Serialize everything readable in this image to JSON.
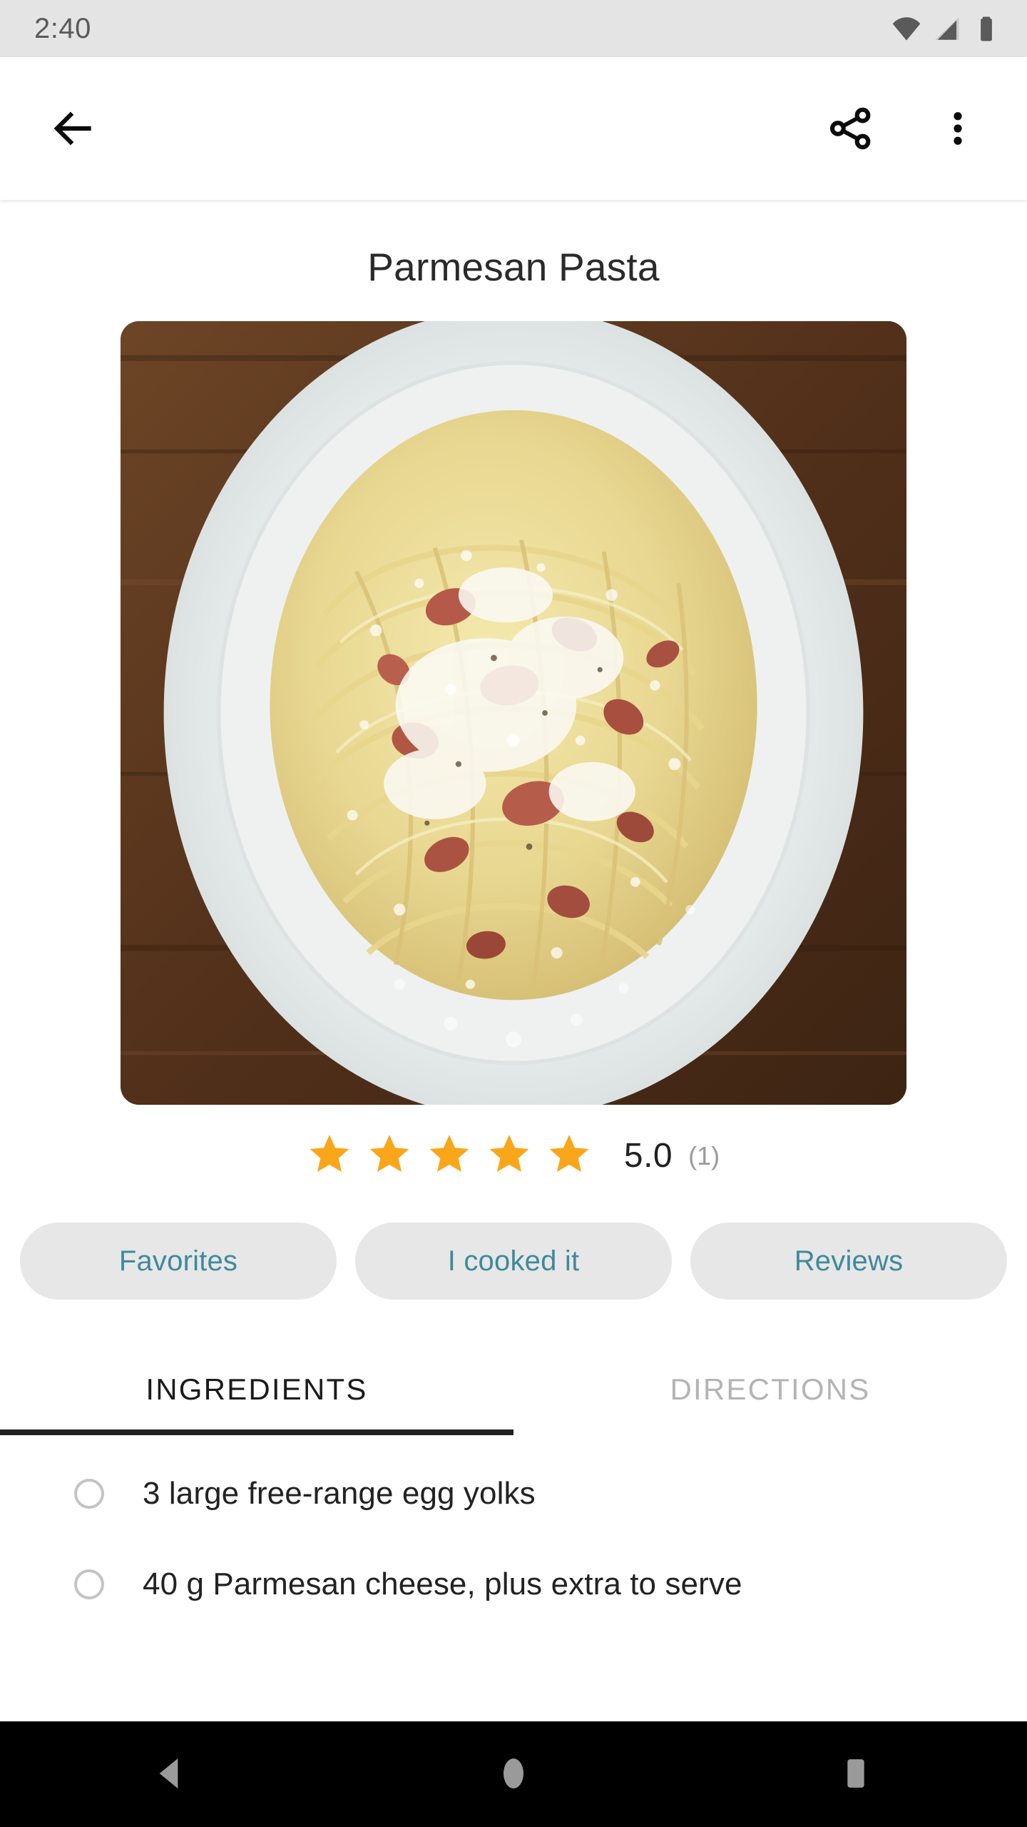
{
  "status_bar": {
    "time": "2:40",
    "icons": [
      "wifi-icon",
      "cellular-signal-icon",
      "battery-icon"
    ],
    "background": "#e4e4e4"
  },
  "app_bar": {
    "back_icon": "back-arrow-icon",
    "share_icon": "share-icon",
    "overflow_icon": "more-vert-icon"
  },
  "recipe": {
    "title": "Parmesan Pasta",
    "image_alt": "spaghetti carbonara with pancetta and grated parmesan on a white oval plate"
  },
  "rating": {
    "stars_filled": 5,
    "stars_total": 5,
    "value": "5.0",
    "count": "(1)",
    "star_color": "#FAA61A"
  },
  "actions": {
    "favorites_label": "Favorites",
    "cooked_label": "I cooked it",
    "reviews_label": "Reviews",
    "chip_background": "#e7e7e7",
    "chip_text_color": "#3f8a9b"
  },
  "tabs": {
    "items": [
      {
        "label": "INGREDIENTS",
        "active": true
      },
      {
        "label": "DIRECTIONS",
        "active": false
      }
    ],
    "indicator_color": "#202020"
  },
  "ingredients": [
    {
      "text": "3 large free-range egg yolks",
      "checked": false
    },
    {
      "text": "40 g Parmesan cheese, plus extra to serve",
      "checked": false
    }
  ],
  "nav_bar": {
    "back_label": "back-triangle-icon",
    "home_label": "home-circle-icon",
    "recents_label": "recents-square-icon",
    "background": "#000000",
    "icon_color": "#9a9a9a"
  }
}
